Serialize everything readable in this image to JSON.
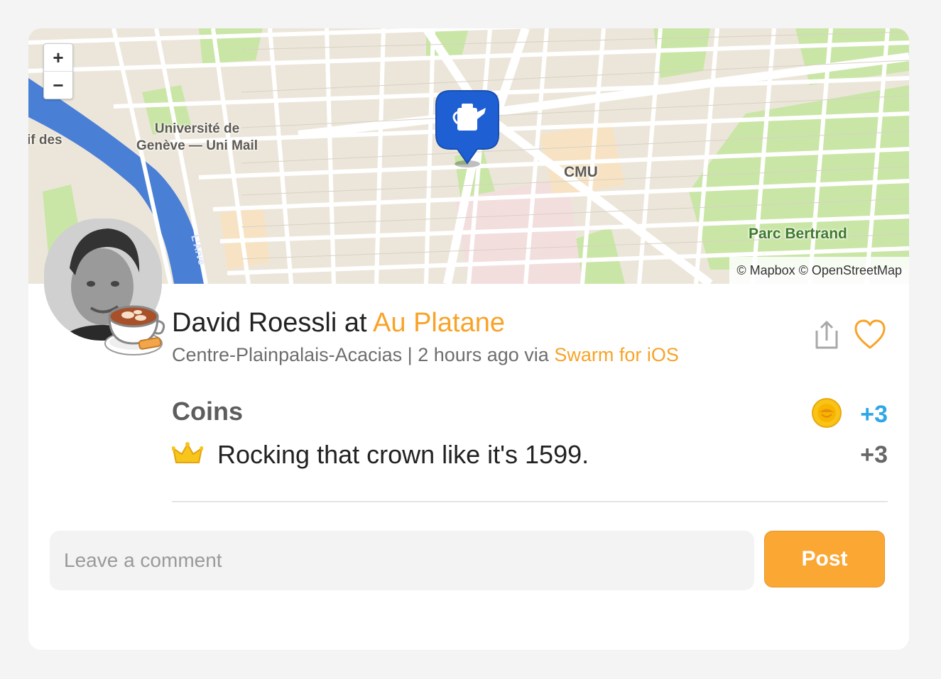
{
  "map": {
    "zoom_in": "+",
    "zoom_out": "−",
    "labels": {
      "university": "Université de\nGenève — Uni Mail",
      "river_left": "if des",
      "cmu": "CMU",
      "park": "Parc Bertrand",
      "river": "L'Arve"
    },
    "attribution": "© Mapbox © OpenStreetMap",
    "pin_icon": "coffee-pot-icon",
    "pin_color": "#1e5fd3"
  },
  "checkin": {
    "user": "David Roessli",
    "at": "at",
    "venue": "Au Platane",
    "neighborhood": "Centre-Plainpalais-Acacias",
    "separator": "|",
    "time": "2 hours ago via",
    "app": "Swarm for iOS",
    "sticker_icon": "coffee-cup-sticker-icon"
  },
  "actions": {
    "share_icon": "share-icon",
    "like_icon": "heart-icon"
  },
  "coins": {
    "heading": "Coins",
    "total": "+3",
    "items": [
      {
        "icon": "crown-icon",
        "text": "Rocking that crown like it's 1599.",
        "points": "+3"
      }
    ]
  },
  "comment": {
    "placeholder": "Leave a comment",
    "value": "",
    "post_label": "Post"
  },
  "colors": {
    "accent": "#f8a328",
    "coins_blue": "#2fa7e6",
    "button": "#fba733",
    "park_green": "#c7e5a4",
    "river_blue": "#4a7fd6"
  }
}
